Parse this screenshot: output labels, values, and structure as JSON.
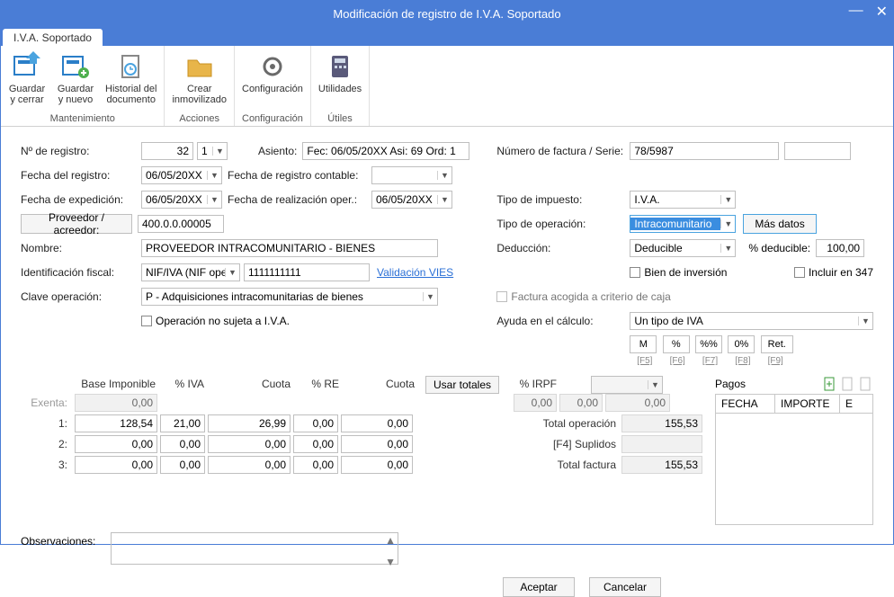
{
  "window": {
    "title": "Modificación de registro de I.V.A. Soportado",
    "tab": "I.V.A. Soportado"
  },
  "ribbon": {
    "groups": [
      {
        "label": "Mantenimiento",
        "items": [
          {
            "name": "guardar-cerrar",
            "label": "Guardar\ny cerrar",
            "arrow": true
          },
          {
            "name": "guardar-nuevo",
            "label": "Guardar\ny nuevo",
            "arrow": true
          },
          {
            "name": "historial",
            "label": "Historial del\ndocumento"
          }
        ]
      },
      {
        "label": "Acciones",
        "items": [
          {
            "name": "crear-inmovilizado",
            "label": "Crear\ninmovilizado"
          }
        ]
      },
      {
        "label": "Configuración",
        "items": [
          {
            "name": "configuracion",
            "label": "Configuración",
            "arrow": true
          }
        ]
      },
      {
        "label": "Útiles",
        "items": [
          {
            "name": "utilidades",
            "label": "Utilidades",
            "arrow": true
          }
        ]
      }
    ]
  },
  "form": {
    "n_registro_label": "Nº de registro:",
    "n_registro": "32",
    "n_registro_serie": "1",
    "asiento_label": "Asiento:",
    "asiento": "Fec: 06/05/20XX Asi: 69 Ord: 1",
    "fecha_registro_label": "Fecha del registro:",
    "fecha_registro": "06/05/20XX",
    "fecha_registro_contable_label": "Fecha de registro contable:",
    "fecha_registro_contable": "",
    "fecha_expedicion_label": "Fecha de expedición:",
    "fecha_expedicion": "06/05/20XX",
    "fecha_realizacion_label": "Fecha de realización oper.:",
    "fecha_realizacion": "06/05/20XX",
    "proveedor_btn": "Proveedor / acreedor:",
    "proveedor_val": "400.0.0.00005",
    "nombre_label": "Nombre:",
    "nombre": "PROVEEDOR INTRACOMUNITARIO - BIENES",
    "id_fiscal_label": "Identificación fiscal:",
    "id_fiscal_tipo": "NIF/IVA (NIF ope",
    "id_fiscal_num": "1111111111",
    "validacion_vies": "Validación VIES",
    "clave_op_label": "Clave operación:",
    "clave_op": "P - Adquisiciones intracomunitarias de bienes",
    "no_sujeta_label": "Operación no sujeta a I.V.A.",
    "num_factura_label": "Número de factura / Serie:",
    "num_factura": "78/5987",
    "tipo_impuesto_label": "Tipo de impuesto:",
    "tipo_impuesto": "I.V.A.",
    "tipo_operacion_label": "Tipo de operación:",
    "tipo_operacion": "Intracomunitario",
    "mas_datos_btn": "Más datos",
    "deduccion_label": "Deducción:",
    "deduccion": "Deducible",
    "pct_deducible_label": "% deducible:",
    "pct_deducible": "100,00",
    "bien_inversion_label": "Bien de inversión",
    "incluir_347_label": "Incluir en 347",
    "factura_caja_label": "Factura acogida a criterio de caja",
    "ayuda_calculo_label": "Ayuda en el cálculo:",
    "ayuda_calculo": "Un tipo de IVA",
    "mini": {
      "m": "M",
      "p": "%",
      "pp": "%%",
      "z": "0%",
      "r": "Ret."
    },
    "mini_keys": {
      "m": "[F5]",
      "p": "[F6]",
      "pp": "[F7]",
      "z": "[F8]",
      "r": "[F9]"
    }
  },
  "grid": {
    "headers": {
      "base": "Base Imponible",
      "iva": "% IVA",
      "cuota": "Cuota",
      "re": "% RE",
      "cuota2": "Cuota",
      "usar": "Usar totales",
      "irpf": "% IRPF"
    },
    "rows": [
      {
        "lbl": "Exenta:",
        "base": "0,00",
        "iva": "",
        "cuota": "",
        "re": "",
        "cuota2": "",
        "ro": true
      },
      {
        "lbl": "1:",
        "base": "128,54",
        "iva": "21,00",
        "cuota": "26,99",
        "re": "0,00",
        "cuota2": "0,00"
      },
      {
        "lbl": "2:",
        "base": "0,00",
        "iva": "0,00",
        "cuota": "0,00",
        "re": "0,00",
        "cuota2": "0,00"
      },
      {
        "lbl": "3:",
        "base": "0,00",
        "iva": "0,00",
        "cuota": "0,00",
        "re": "0,00",
        "cuota2": "0,00"
      }
    ],
    "irpf_triplet": [
      "0,00",
      "0,00",
      "0,00"
    ],
    "totals": [
      {
        "lbl": "Total operación",
        "val": "155,53"
      },
      {
        "lbl": "[F4] Suplidos",
        "val": ""
      },
      {
        "lbl": "Total factura",
        "val": "155,53"
      }
    ],
    "pagos_label": "Pagos",
    "pay_cols": {
      "fecha": "FECHA",
      "importe": "IMPORTE",
      "e": "E"
    }
  },
  "obs_label": "Observaciones:",
  "footer": {
    "aceptar": "Aceptar",
    "cancelar": "Cancelar"
  }
}
